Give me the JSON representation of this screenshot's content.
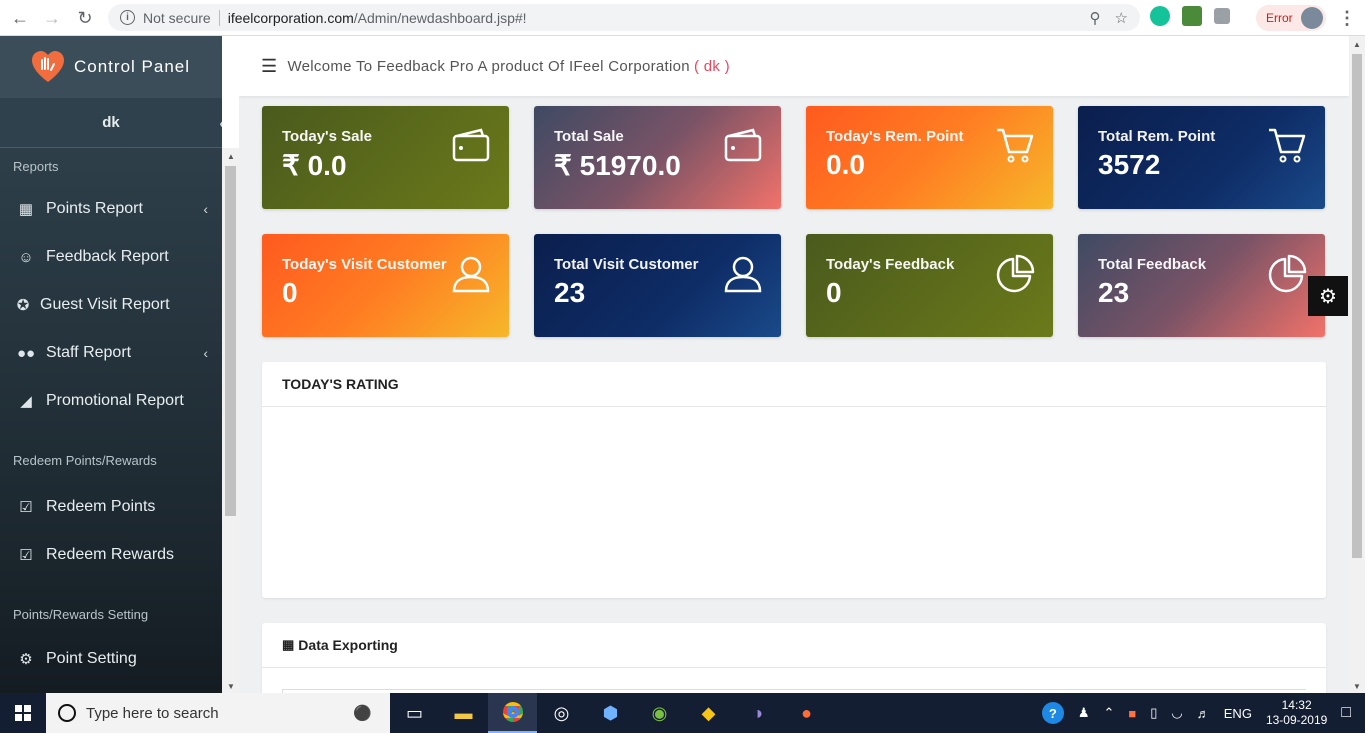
{
  "browser": {
    "not_secure": "Not secure",
    "host": "ifeelcorporation.com",
    "path": "/Admin/newdashboard.jsp#!",
    "error_label": "Error"
  },
  "sidebar": {
    "brand": "Control Panel",
    "user": "dk",
    "sections": {
      "reports": "Reports",
      "redeem": "Redeem Points/Rewards",
      "settings": "Points/Rewards Setting"
    },
    "items": [
      {
        "label": "Points Report",
        "icon": "dashboard-icon"
      },
      {
        "label": "Feedback Report",
        "icon": "smile-icon"
      },
      {
        "label": "Guest Visit Report",
        "icon": "walking-icon"
      },
      {
        "label": "Staff Report",
        "icon": "users-icon"
      },
      {
        "label": "Promotional Report",
        "icon": "tag-icon"
      },
      {
        "label": "Redeem Points",
        "icon": "calendar-check-icon"
      },
      {
        "label": "Redeem Rewards",
        "icon": "calendar-check-icon"
      },
      {
        "label": "Point Setting",
        "icon": "gear-icon"
      }
    ]
  },
  "header": {
    "welcome": "Welcome To Feedback Pro A product Of IFeel Corporation",
    "user_open": "( dk )"
  },
  "cards": [
    {
      "title": "Today's Sale",
      "value": "₹ 0.0",
      "icon": "wallet-icon"
    },
    {
      "title": "Total Sale",
      "value": "₹ 51970.0",
      "icon": "wallet-icon"
    },
    {
      "title": "Today's Rem. Point",
      "value": "0.0",
      "icon": "cart-icon"
    },
    {
      "title": "Total Rem. Point",
      "value": "3572",
      "icon": "cart-icon"
    },
    {
      "title": "Today's Visit Customer",
      "value": "0",
      "icon": "user-icon"
    },
    {
      "title": "Total Visit Customer",
      "value": "23",
      "icon": "user-icon"
    },
    {
      "title": "Today's Feedback",
      "value": "0",
      "icon": "pie-chart-icon"
    },
    {
      "title": "Total Feedback",
      "value": "23",
      "icon": "pie-chart-icon"
    }
  ],
  "panels": {
    "rating_title": "TODAY'S RATING",
    "export_title": "Data Exporting"
  },
  "taskbar": {
    "search_placeholder": "Type here to search",
    "lang": "ENG",
    "time": "14:32",
    "date": "13-09-2019"
  }
}
